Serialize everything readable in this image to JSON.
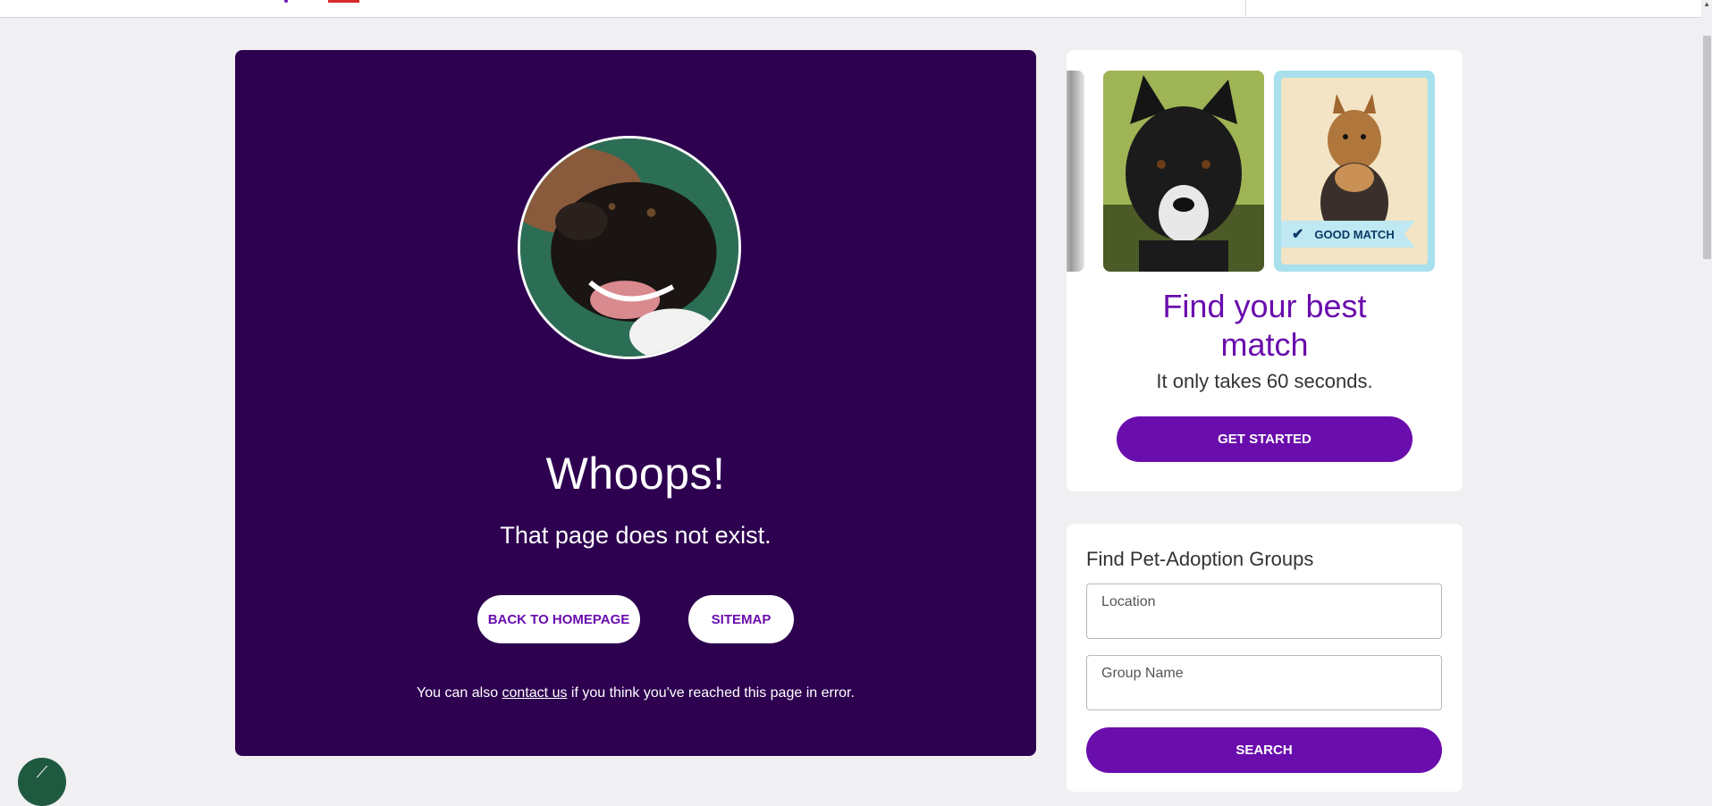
{
  "error": {
    "title": "Whoops!",
    "subtitle": "That page does not exist.",
    "home_button": "BACK TO HOMEPAGE",
    "sitemap_button": "SITEMAP",
    "note_prefix": "You can also ",
    "note_link": "contact us",
    "note_suffix": " if you think you've reached this page in error."
  },
  "match": {
    "badge": "GOOD MATCH",
    "title_line1": "Find your best",
    "title_line2": "match",
    "subtitle": "It only takes 60 seconds.",
    "cta": "GET STARTED"
  },
  "groups": {
    "title": "Find Pet-Adoption Groups",
    "location_label": "Location",
    "group_label": "Group Name",
    "search_button": "SEARCH"
  },
  "icons": {
    "check": "check-icon",
    "chat": "chat-icon"
  },
  "colors": {
    "panel": "#2d0050",
    "accent": "#6a0dad",
    "badge": "#bfe8f3"
  }
}
